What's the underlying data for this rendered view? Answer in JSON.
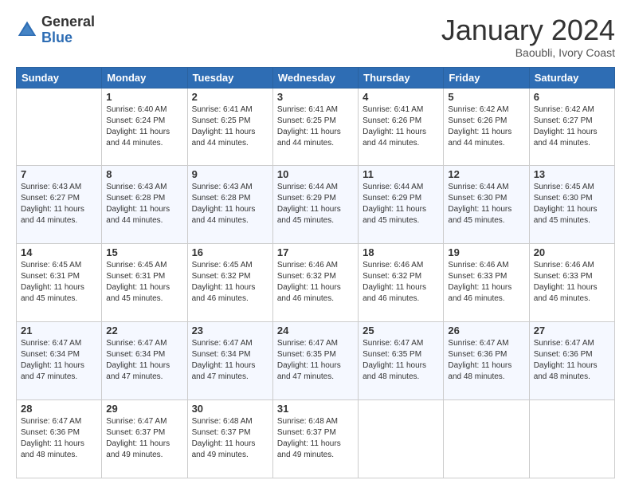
{
  "logo": {
    "general": "General",
    "blue": "Blue"
  },
  "header": {
    "month": "January 2024",
    "location": "Baoubli, Ivory Coast"
  },
  "weekdays": [
    "Sunday",
    "Monday",
    "Tuesday",
    "Wednesday",
    "Thursday",
    "Friday",
    "Saturday"
  ],
  "weeks": [
    [
      {
        "day": "",
        "info": ""
      },
      {
        "day": "1",
        "info": "Sunrise: 6:40 AM\nSunset: 6:24 PM\nDaylight: 11 hours\nand 44 minutes."
      },
      {
        "day": "2",
        "info": "Sunrise: 6:41 AM\nSunset: 6:25 PM\nDaylight: 11 hours\nand 44 minutes."
      },
      {
        "day": "3",
        "info": "Sunrise: 6:41 AM\nSunset: 6:25 PM\nDaylight: 11 hours\nand 44 minutes."
      },
      {
        "day": "4",
        "info": "Sunrise: 6:41 AM\nSunset: 6:26 PM\nDaylight: 11 hours\nand 44 minutes."
      },
      {
        "day": "5",
        "info": "Sunrise: 6:42 AM\nSunset: 6:26 PM\nDaylight: 11 hours\nand 44 minutes."
      },
      {
        "day": "6",
        "info": "Sunrise: 6:42 AM\nSunset: 6:27 PM\nDaylight: 11 hours\nand 44 minutes."
      }
    ],
    [
      {
        "day": "7",
        "info": "Sunrise: 6:43 AM\nSunset: 6:27 PM\nDaylight: 11 hours\nand 44 minutes."
      },
      {
        "day": "8",
        "info": "Sunrise: 6:43 AM\nSunset: 6:28 PM\nDaylight: 11 hours\nand 44 minutes."
      },
      {
        "day": "9",
        "info": "Sunrise: 6:43 AM\nSunset: 6:28 PM\nDaylight: 11 hours\nand 44 minutes."
      },
      {
        "day": "10",
        "info": "Sunrise: 6:44 AM\nSunset: 6:29 PM\nDaylight: 11 hours\nand 45 minutes."
      },
      {
        "day": "11",
        "info": "Sunrise: 6:44 AM\nSunset: 6:29 PM\nDaylight: 11 hours\nand 45 minutes."
      },
      {
        "day": "12",
        "info": "Sunrise: 6:44 AM\nSunset: 6:30 PM\nDaylight: 11 hours\nand 45 minutes."
      },
      {
        "day": "13",
        "info": "Sunrise: 6:45 AM\nSunset: 6:30 PM\nDaylight: 11 hours\nand 45 minutes."
      }
    ],
    [
      {
        "day": "14",
        "info": "Sunrise: 6:45 AM\nSunset: 6:31 PM\nDaylight: 11 hours\nand 45 minutes."
      },
      {
        "day": "15",
        "info": "Sunrise: 6:45 AM\nSunset: 6:31 PM\nDaylight: 11 hours\nand 45 minutes."
      },
      {
        "day": "16",
        "info": "Sunrise: 6:45 AM\nSunset: 6:32 PM\nDaylight: 11 hours\nand 46 minutes."
      },
      {
        "day": "17",
        "info": "Sunrise: 6:46 AM\nSunset: 6:32 PM\nDaylight: 11 hours\nand 46 minutes."
      },
      {
        "day": "18",
        "info": "Sunrise: 6:46 AM\nSunset: 6:32 PM\nDaylight: 11 hours\nand 46 minutes."
      },
      {
        "day": "19",
        "info": "Sunrise: 6:46 AM\nSunset: 6:33 PM\nDaylight: 11 hours\nand 46 minutes."
      },
      {
        "day": "20",
        "info": "Sunrise: 6:46 AM\nSunset: 6:33 PM\nDaylight: 11 hours\nand 46 minutes."
      }
    ],
    [
      {
        "day": "21",
        "info": "Sunrise: 6:47 AM\nSunset: 6:34 PM\nDaylight: 11 hours\nand 47 minutes."
      },
      {
        "day": "22",
        "info": "Sunrise: 6:47 AM\nSunset: 6:34 PM\nDaylight: 11 hours\nand 47 minutes."
      },
      {
        "day": "23",
        "info": "Sunrise: 6:47 AM\nSunset: 6:34 PM\nDaylight: 11 hours\nand 47 minutes."
      },
      {
        "day": "24",
        "info": "Sunrise: 6:47 AM\nSunset: 6:35 PM\nDaylight: 11 hours\nand 47 minutes."
      },
      {
        "day": "25",
        "info": "Sunrise: 6:47 AM\nSunset: 6:35 PM\nDaylight: 11 hours\nand 48 minutes."
      },
      {
        "day": "26",
        "info": "Sunrise: 6:47 AM\nSunset: 6:36 PM\nDaylight: 11 hours\nand 48 minutes."
      },
      {
        "day": "27",
        "info": "Sunrise: 6:47 AM\nSunset: 6:36 PM\nDaylight: 11 hours\nand 48 minutes."
      }
    ],
    [
      {
        "day": "28",
        "info": "Sunrise: 6:47 AM\nSunset: 6:36 PM\nDaylight: 11 hours\nand 48 minutes."
      },
      {
        "day": "29",
        "info": "Sunrise: 6:47 AM\nSunset: 6:37 PM\nDaylight: 11 hours\nand 49 minutes."
      },
      {
        "day": "30",
        "info": "Sunrise: 6:48 AM\nSunset: 6:37 PM\nDaylight: 11 hours\nand 49 minutes."
      },
      {
        "day": "31",
        "info": "Sunrise: 6:48 AM\nSunset: 6:37 PM\nDaylight: 11 hours\nand 49 minutes."
      },
      {
        "day": "",
        "info": ""
      },
      {
        "day": "",
        "info": ""
      },
      {
        "day": "",
        "info": ""
      }
    ]
  ]
}
